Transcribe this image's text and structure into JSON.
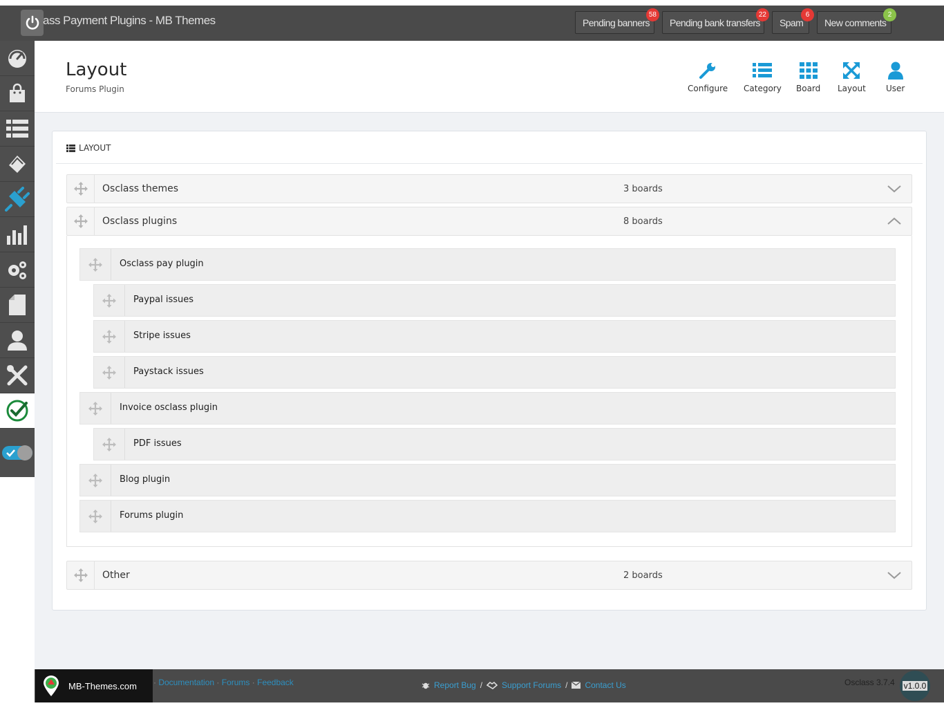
{
  "topbar": {
    "title": "ass Payment Plugins - MB Themes",
    "notifications": [
      {
        "label": "Pending banners",
        "count": "58",
        "color": "#e53935"
      },
      {
        "label": "Pending bank transfers",
        "count": "22",
        "color": "#e53935"
      },
      {
        "label": "Spam",
        "count": "6",
        "color": "#e53935"
      },
      {
        "label": "New comments",
        "count": "2",
        "color": "#8bc34a"
      }
    ]
  },
  "sidebar": {
    "items": [
      "dashboard-icon",
      "shop-bag-icon",
      "list-icon",
      "tag-icon",
      "plugin-icon",
      "bar-chart-icon",
      "gears-icon",
      "page-icon",
      "user-icon",
      "tools-icon",
      "check-icon"
    ],
    "active_color": "#2aa0cf"
  },
  "header": {
    "title": "Layout",
    "subtitle": "Forums Plugin",
    "nav": [
      {
        "label": "Configure",
        "icon": "wrench-icon"
      },
      {
        "label": "Category",
        "icon": "list-icon"
      },
      {
        "label": "Board",
        "icon": "grid-icon"
      },
      {
        "label": "Layout",
        "icon": "expand-icon"
      },
      {
        "label": "User",
        "icon": "user-icon"
      }
    ],
    "accent": "#1a9ad6"
  },
  "card": {
    "heading": "LAYOUT",
    "categories": [
      {
        "name": "Osclass themes",
        "count": "3 boards",
        "expanded": false
      },
      {
        "name": "Osclass plugins",
        "count": "8 boards",
        "expanded": true
      },
      {
        "name": "Other",
        "count": "2 boards",
        "expanded": false
      }
    ],
    "boards": [
      {
        "name": "Osclass pay plugin"
      },
      {
        "name": "Paypal issues"
      },
      {
        "name": "Stripe issues"
      },
      {
        "name": "Paystack issues"
      },
      {
        "name": "Invoice osclass plugin"
      },
      {
        "name": "PDF issues"
      },
      {
        "name": "Blog plugin"
      },
      {
        "name": "Forums plugin"
      }
    ]
  },
  "footer": {
    "brand": "MB-Themes.com",
    "links": [
      "Documentation",
      "Forums",
      "Feedback"
    ],
    "link_sep": "·",
    "mid_links": [
      "Report Bug",
      "Support Forums",
      "Contact Us"
    ],
    "slash": "/",
    "version": "Osclass 3.7.4",
    "badge": "v1.0.0"
  }
}
